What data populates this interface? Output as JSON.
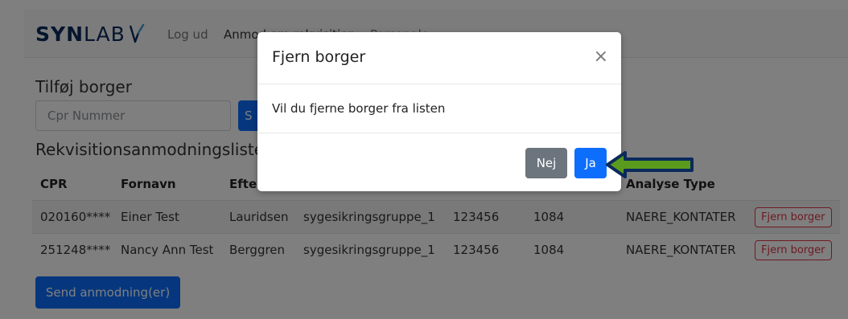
{
  "colors": {
    "primary": "#0d6efd",
    "secondary": "#6c757d",
    "danger": "#dc3545",
    "brand": "#0b2a5b",
    "arrow_fill": "#5a9a1c",
    "arrow_outline": "#0b2a5b"
  },
  "navbar": {
    "logo_bold": "SYN",
    "logo_light": "LAB",
    "logo_icon": "synlab-logo-icon",
    "logout": "Log ud",
    "request": "Anmod om rekvisition",
    "persons": "Personale"
  },
  "add": {
    "heading": "Tilføj borger",
    "cpr_placeholder": "Cpr Nummer",
    "search_label": "S"
  },
  "list": {
    "heading": "Rekvisitionsanmodningsliste",
    "columns": [
      "CPR",
      "Fornavn",
      "Efter",
      "",
      "",
      "",
      "Analyse Type",
      ""
    ],
    "rows": [
      {
        "cpr": "020160****",
        "first": "Einer Test",
        "last": "Lauridsen",
        "group": "sygesikringsgruppe_1",
        "num": "123456",
        "code": "1084",
        "type": "NAERE_KONTATER",
        "action": "Fjern borger"
      },
      {
        "cpr": "251248****",
        "first": "Nancy Ann Test",
        "last": "Berggren",
        "group": "sygesikringsgruppe_1",
        "num": "123456",
        "code": "1084",
        "type": "NAERE_KONTATER",
        "action": "Fjern borger"
      }
    ]
  },
  "send_button": "Send anmodning(er)",
  "modal": {
    "title": "Fjern borger",
    "close": "×",
    "body": "Vil du fjerne borger fra listen",
    "no": "Nej",
    "yes": "Ja"
  },
  "annotation": {
    "icon": "arrow-left-icon"
  }
}
